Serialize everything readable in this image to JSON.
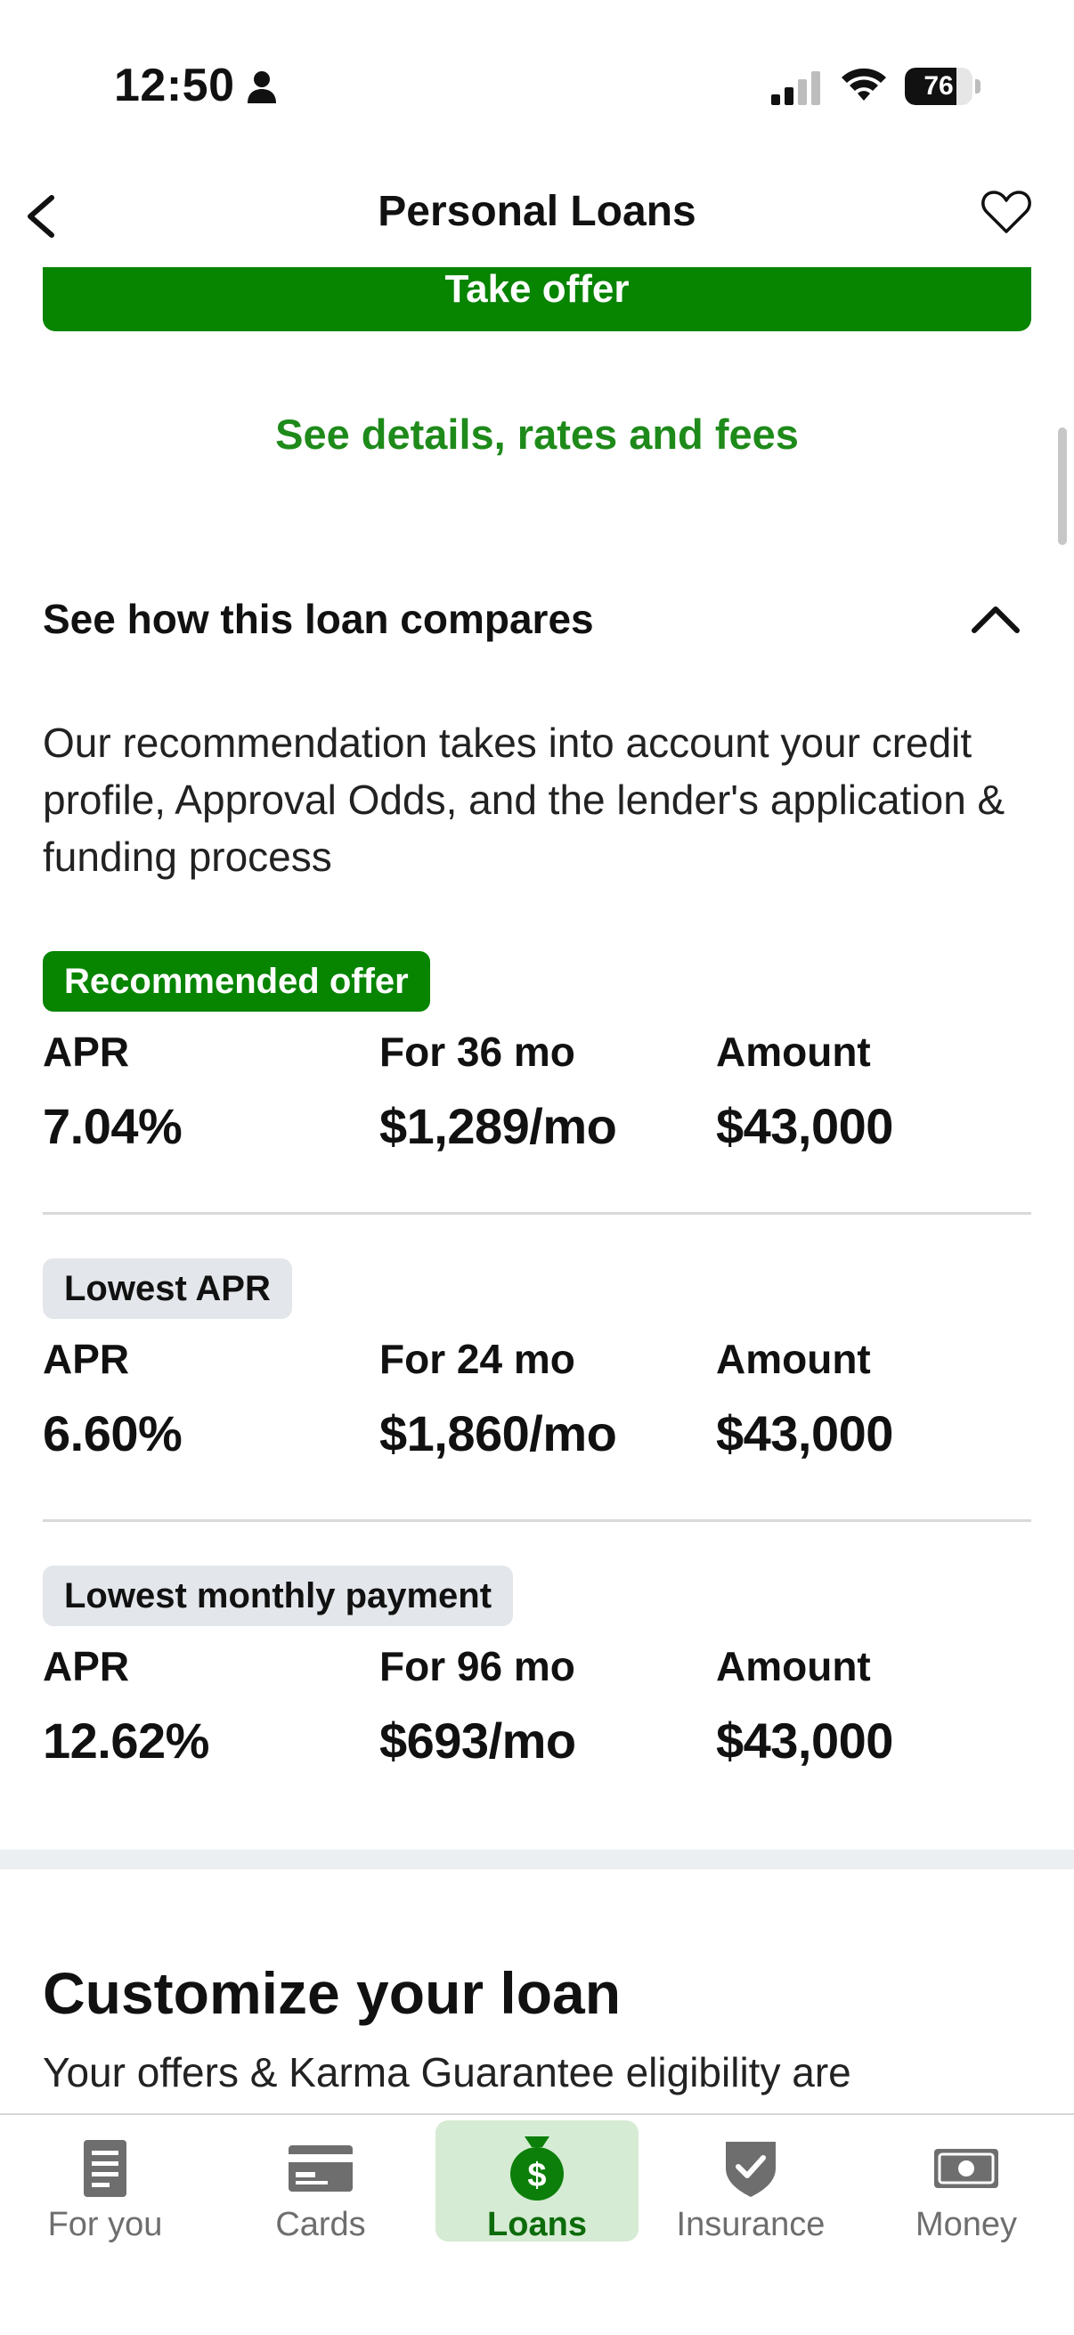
{
  "status_bar": {
    "time": "12:50",
    "battery": "76",
    "battery_level": 0.76,
    "icons": [
      "person-icon",
      "signal-icon",
      "wifi-icon",
      "battery-icon"
    ]
  },
  "header": {
    "title": "Personal Loans",
    "icons": [
      "back-arrow-icon",
      "heart-icon"
    ]
  },
  "main": {
    "take_offer_label": "Take offer",
    "details_link": "See details, rates and fees",
    "compare_title": "See how this loan compares",
    "description": "Our recommendation takes into account your credit profile, Approval Odds, and the lender's application & funding process",
    "offers": [
      {
        "badge": "Recommended offer",
        "apr_label": "APR",
        "apr": "7.04%",
        "term_label": "For 36 mo",
        "payment": "$1,289/mo",
        "amount_label": "Amount",
        "amount": "$43,000"
      },
      {
        "badge": "Lowest APR",
        "apr_label": "APR",
        "apr": "6.60%",
        "term_label": "For 24 mo",
        "payment": "$1,860/mo",
        "amount_label": "Amount",
        "amount": "$43,000"
      },
      {
        "badge": "Lowest monthly payment",
        "apr_label": "APR",
        "apr": "12.62%",
        "term_label": "For 96 mo",
        "payment": "$693/mo",
        "amount_label": "Amount",
        "amount": "$43,000"
      }
    ],
    "customize_title": "Customize your loan",
    "customize_sub": "Your offers & Karma Guarantee eligibility are"
  },
  "tab_bar": {
    "tabs": [
      {
        "label": "For you",
        "icon": "document-icon",
        "active": false
      },
      {
        "label": "Cards",
        "icon": "credit-card-icon",
        "active": false
      },
      {
        "label": "Loans",
        "icon": "money-bag-icon",
        "active": true
      },
      {
        "label": "Insurance",
        "icon": "shield-check-icon",
        "active": false
      },
      {
        "label": "Money",
        "icon": "banknote-icon",
        "active": false
      }
    ]
  },
  "colors": {
    "brand_green": "#078400",
    "link_green": "#1e8a1a",
    "tab_active_bg": "#d6ebd4",
    "badge_gray": "#e3e6ea"
  }
}
